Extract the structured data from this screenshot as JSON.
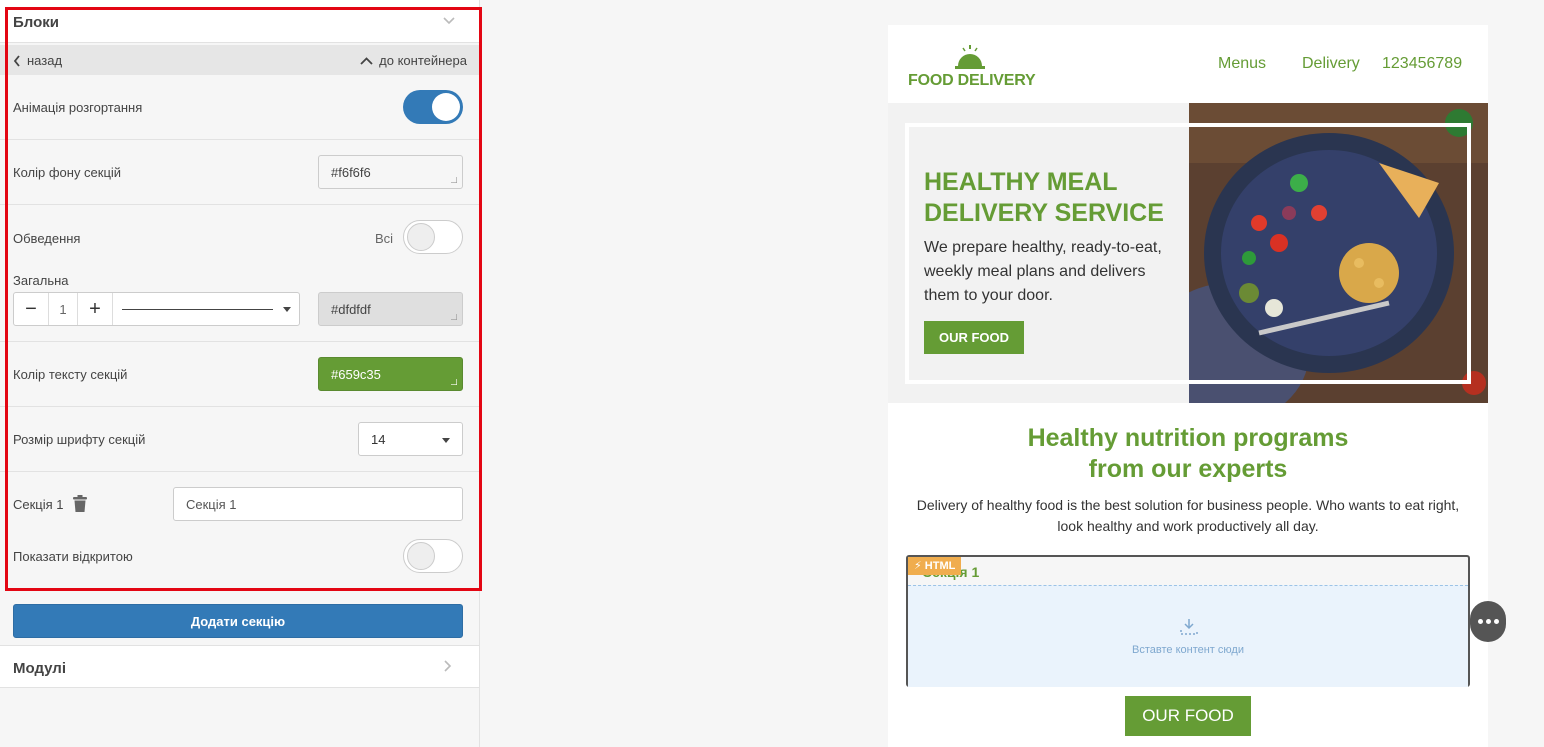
{
  "panel": {
    "blocks_title": "Блоки",
    "back_label": "назад",
    "to_container_label": "до контейнера",
    "expand_animation_label": "Анімація розгортання",
    "section_bg_label": "Колір фону секцій",
    "section_bg_value": "#f6f6f6",
    "border_label": "Обведення",
    "border_all_label": "Всі",
    "general_label": "Загальна",
    "border_width_value": "1",
    "border_color_value": "#dfdfdf",
    "section_text_color_label": "Колір тексту секцій",
    "section_text_color_value": "#659c35",
    "section_font_size_label": "Розмір шрифту секцій",
    "section_font_size_value": "14",
    "section1_label": "Секція 1",
    "section1_input_value": "Секція 1",
    "show_open_label": "Показати відкритою",
    "add_section_label": "Додати секцію",
    "modules_title": "Модулі"
  },
  "email": {
    "logo_text": "FOOD DELIVERY",
    "nav": [
      "Menus",
      "Delivery",
      "123456789"
    ],
    "hero_title": [
      "HEALTHY MEAL",
      "DELIVERY SERVICE"
    ],
    "hero_text": "We prepare healthy, ready-to-eat, weekly meal plans and delivers them to your door.",
    "hero_button": "OUR FOOD",
    "section_title": [
      "Healthy nutrition programs",
      "from our experts"
    ],
    "section_desc": "Delivery of healthy food is the best solution for business people. Who wants to eat right, look healthy and work productively all day.",
    "accordion_tag": "HTML",
    "accordion_section_name": "Секція 1",
    "drop_text": "Вставте контент сюди",
    "button2": "OUR FOOD"
  },
  "colors": {
    "accent_green": "#659c35",
    "primary_blue": "#337ab7",
    "highlight_red": "#e30613"
  }
}
